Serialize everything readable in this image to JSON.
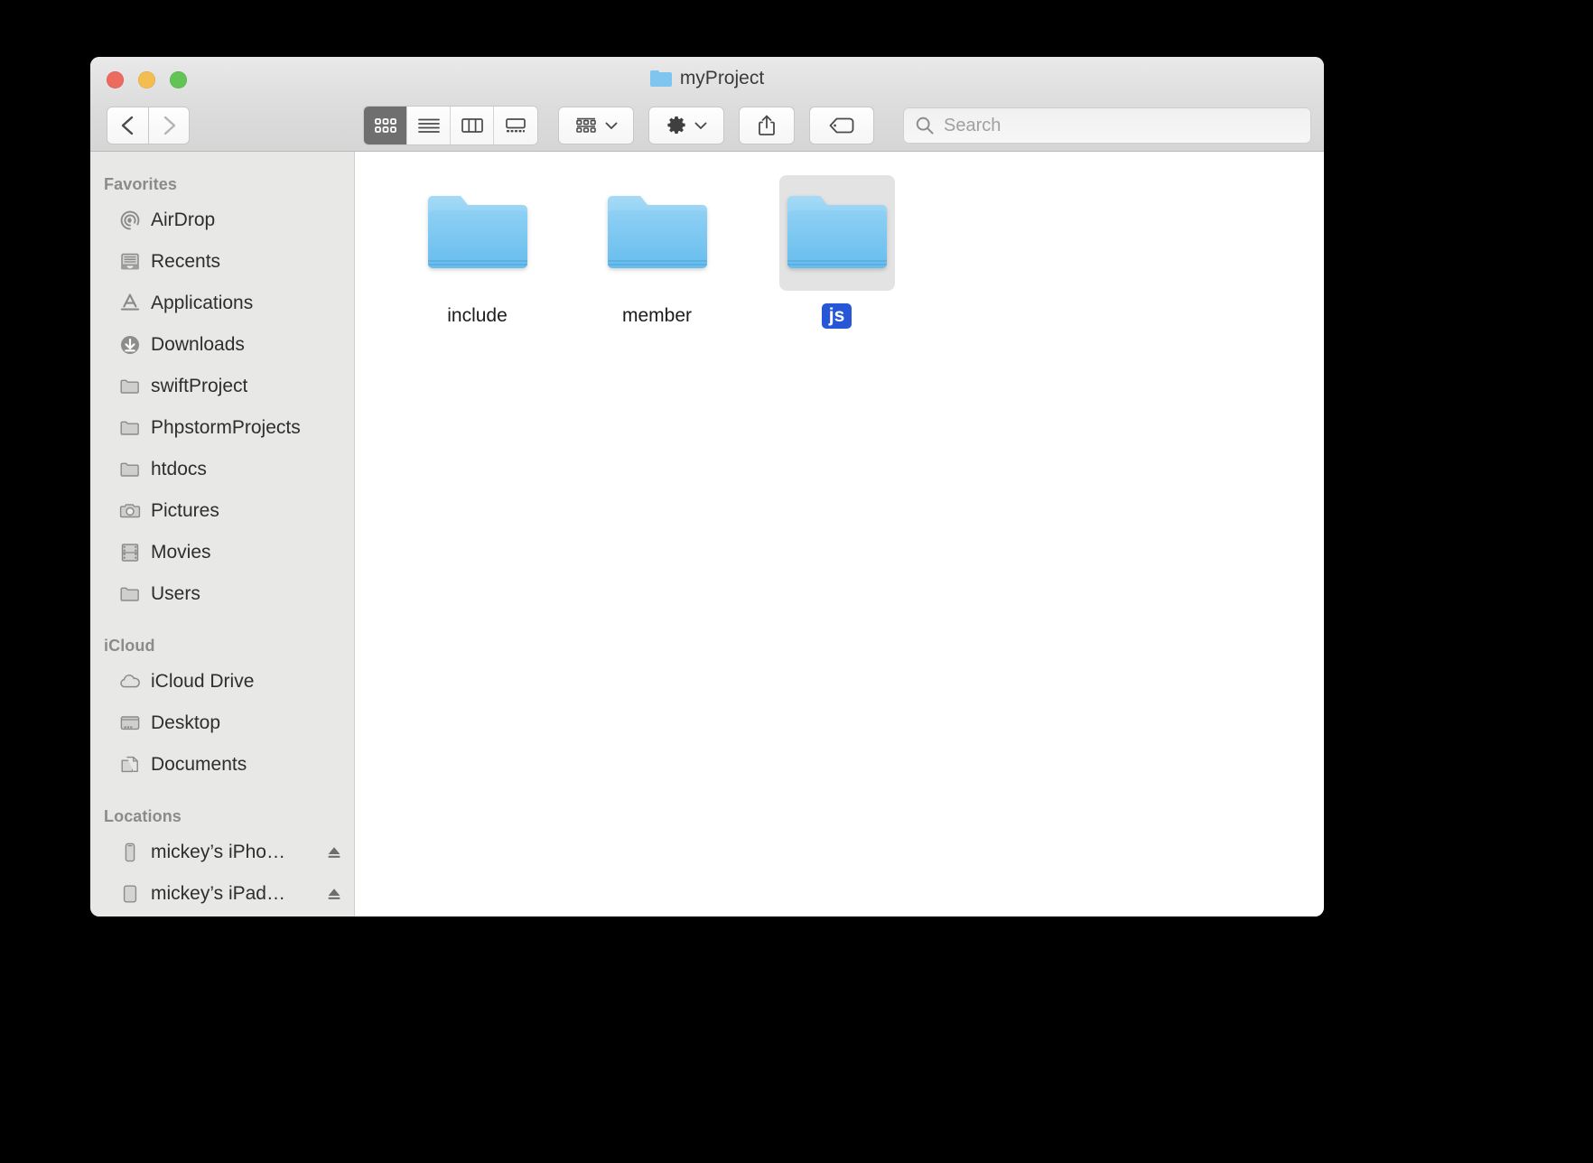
{
  "window": {
    "title": "myProject",
    "title_icon": "folder-icon",
    "traffic_lights": [
      {
        "name": "close-button",
        "color": "#ec6a5f"
      },
      {
        "name": "minimize-button",
        "color": "#f4bd4f"
      },
      {
        "name": "maximize-button",
        "color": "#61c454"
      }
    ]
  },
  "toolbar": {
    "back_label": "back-icon",
    "forward_label": "forward-icon",
    "view_modes": [
      {
        "name": "icon-view",
        "icon": "grid-icon",
        "active": true
      },
      {
        "name": "list-view",
        "icon": "list-icon",
        "active": false
      },
      {
        "name": "column-view",
        "icon": "columns-icon",
        "active": false
      },
      {
        "name": "gallery-view",
        "icon": "gallery-icon",
        "active": false
      }
    ],
    "arrange_icon": "arrange-grid-icon",
    "action_icon": "gear-icon",
    "share_icon": "share-icon",
    "tag_icon": "tag-icon",
    "dropdown_icon": "chevron-down-icon"
  },
  "search": {
    "placeholder": "Search",
    "value": "",
    "icon": "search-icon"
  },
  "sidebar": {
    "sections": [
      {
        "header": "Favorites",
        "items": [
          {
            "label": "AirDrop",
            "icon": "airdrop-icon",
            "eject": false
          },
          {
            "label": "Recents",
            "icon": "recents-icon",
            "eject": false
          },
          {
            "label": "Applications",
            "icon": "applications-icon",
            "eject": false
          },
          {
            "label": "Downloads",
            "icon": "downloads-icon",
            "eject": false
          },
          {
            "label": "swiftProject",
            "icon": "folder-icon",
            "eject": false
          },
          {
            "label": "PhpstormProjects",
            "icon": "folder-icon",
            "eject": false
          },
          {
            "label": "htdocs",
            "icon": "folder-icon",
            "eject": false
          },
          {
            "label": "Pictures",
            "icon": "pictures-icon",
            "eject": false
          },
          {
            "label": "Movies",
            "icon": "movies-icon",
            "eject": false
          },
          {
            "label": "Users",
            "icon": "folder-icon",
            "eject": false
          }
        ]
      },
      {
        "header": "iCloud",
        "items": [
          {
            "label": "iCloud Drive",
            "icon": "cloud-icon",
            "eject": false
          },
          {
            "label": "Desktop",
            "icon": "desktop-icon",
            "eject": false
          },
          {
            "label": "Documents",
            "icon": "documents-icon",
            "eject": false
          }
        ]
      },
      {
        "header": "Locations",
        "items": [
          {
            "label": "mickey’s iPho…",
            "icon": "iphone-icon",
            "eject": true
          },
          {
            "label": "mickey’s iPad…",
            "icon": "ipad-icon",
            "eject": true
          }
        ]
      }
    ]
  },
  "content": {
    "items": [
      {
        "label": "include",
        "icon": "folder-icon",
        "selected": false
      },
      {
        "label": "member",
        "icon": "folder-icon",
        "selected": false
      },
      {
        "label": "js",
        "icon": "folder-icon",
        "selected": true
      }
    ]
  },
  "colors": {
    "selection_blue": "#2757d6",
    "folder_blue": "#6cc0ee",
    "sidebar_bg": "#e8e8e6",
    "titlebar_bg": "#dcdcdc"
  }
}
